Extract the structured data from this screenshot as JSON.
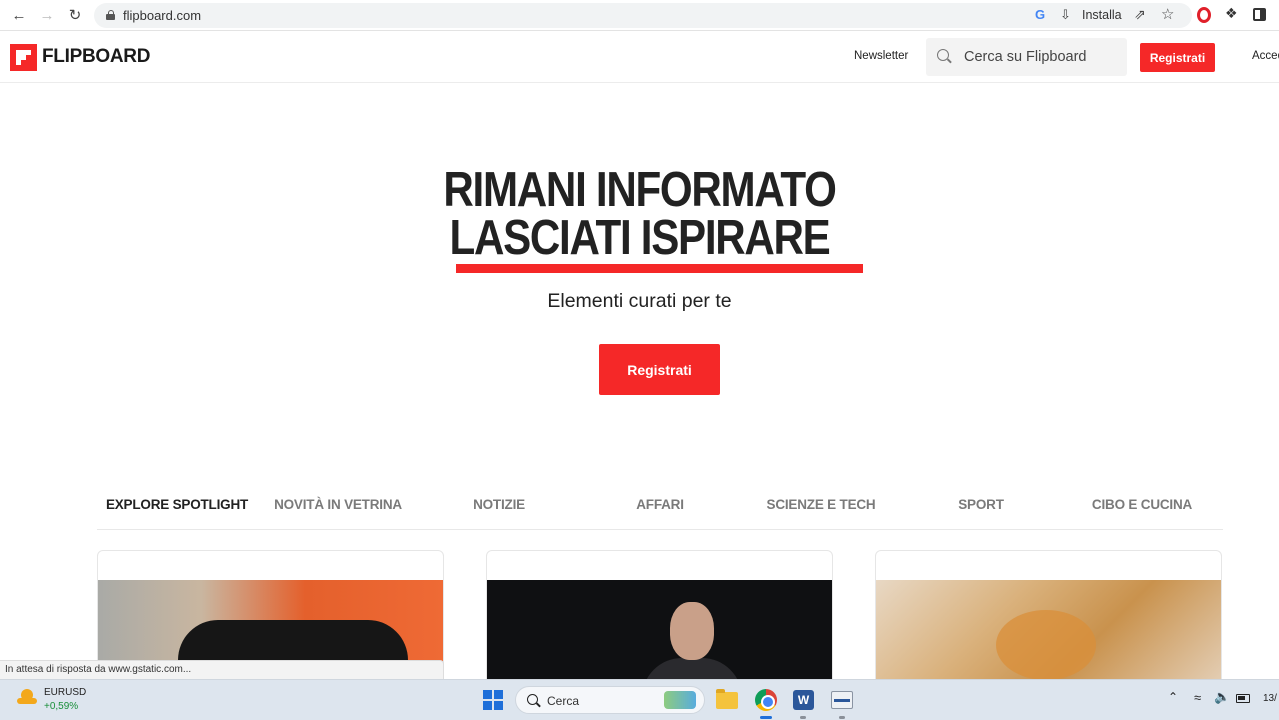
{
  "browser": {
    "url": "flipboard.com",
    "install_label": "Installa"
  },
  "header": {
    "logo": "FLIPBOARD",
    "newsletter": "Newsletter",
    "search_placeholder": "Cerca su Flipboard",
    "register": "Registrati",
    "access": "Accedi"
  },
  "hero": {
    "line1": "RIMANI INFORMATO",
    "line2": "LASCIATI ISPIRARE",
    "subtitle": "Elementi curati per te",
    "cta": "Registrati"
  },
  "tabs": [
    "EXPLORE SPOTLIGHT",
    "NOVITÀ IN VETRINA",
    "NOTIZIE",
    "AFFARI",
    "SCIENZE E TECH",
    "SPORT",
    "CIBO E CUCINA"
  ],
  "status_text": "In attesa di risposta da www.gstatic.com...",
  "taskbar": {
    "ticker_name": "EURUSD",
    "ticker_value": "+0,59%",
    "search_label": "Cerca",
    "clock": "13/"
  },
  "colors": {
    "brand_red": "#f52828"
  }
}
